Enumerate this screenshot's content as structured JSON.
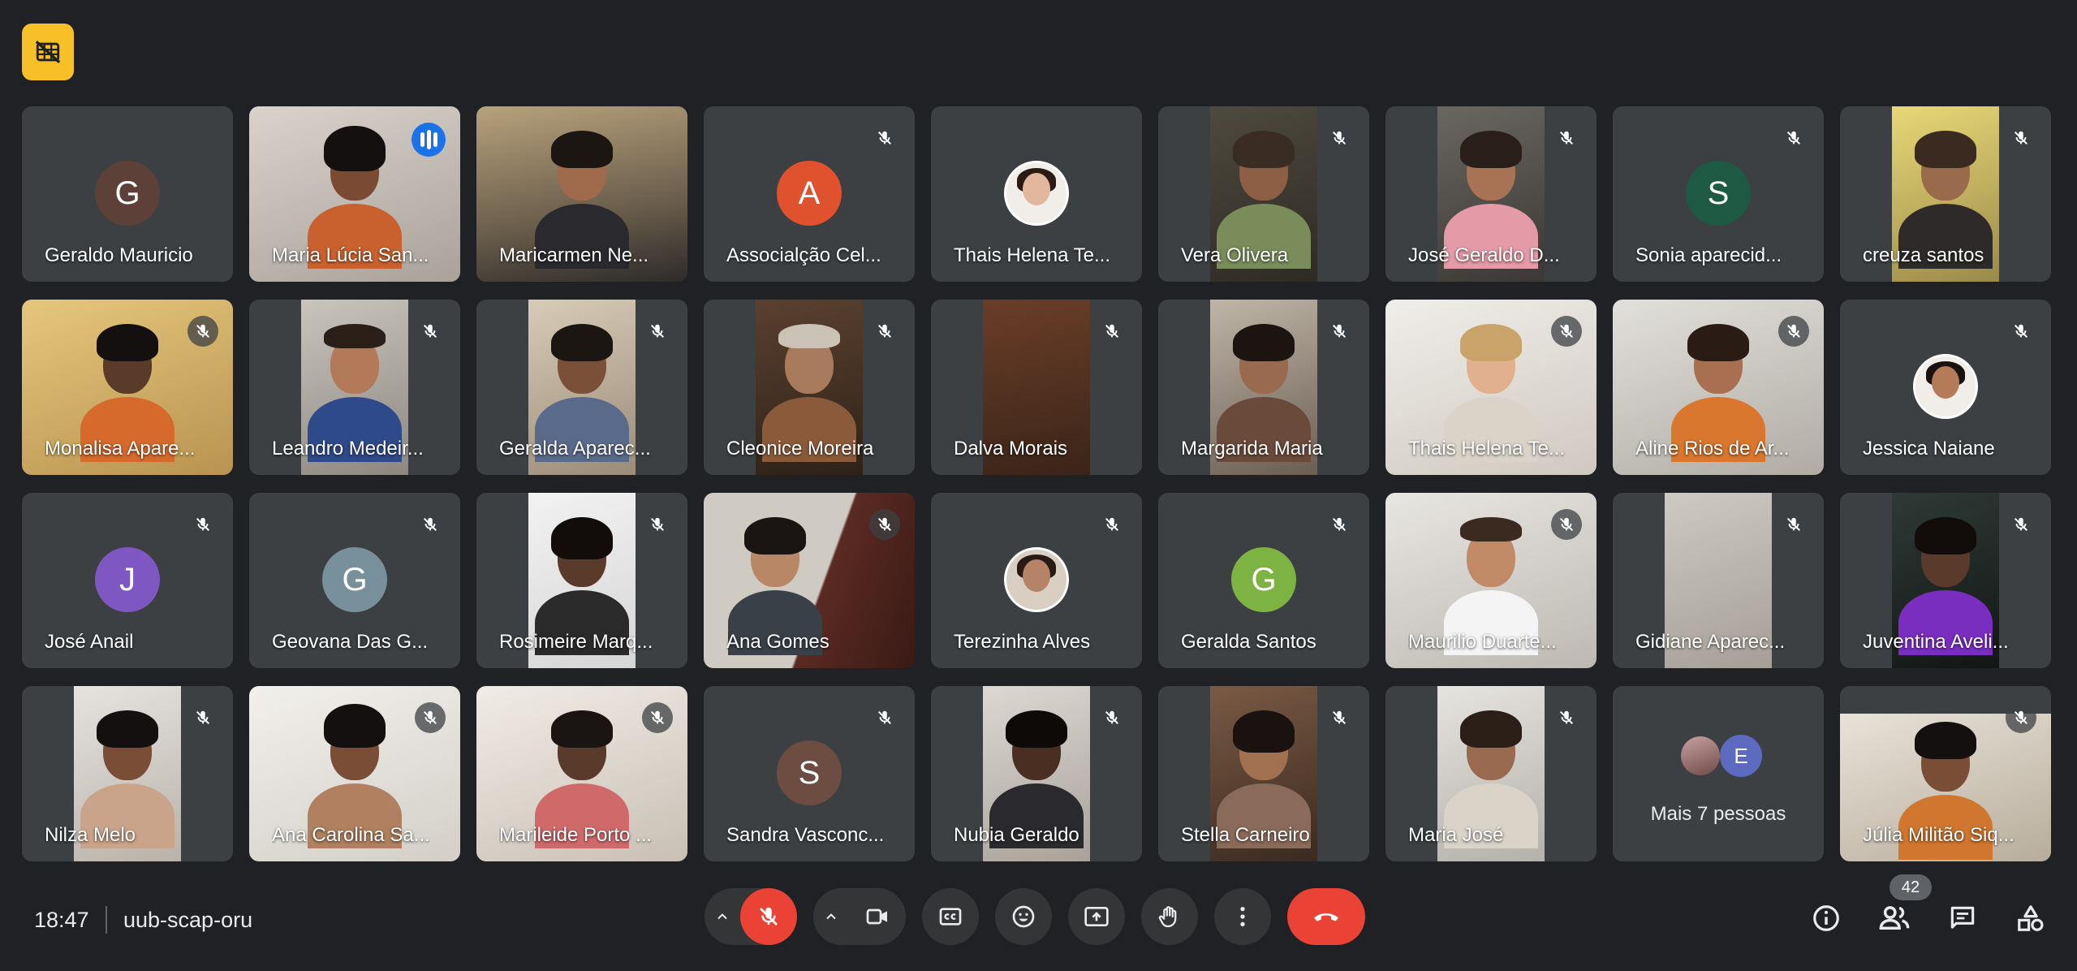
{
  "meeting": {
    "time": "18:47",
    "code": "uub-scap-oru",
    "participant_count": "42"
  },
  "colors": {
    "background": "#202124",
    "tile": "#3c4043",
    "mute_red": "#ea4335",
    "speaking_blue": "#1a73e8",
    "badge_yellow": "#f6c026"
  },
  "participants": [
    {
      "name": "Geraldo Mauricio",
      "initial": "G",
      "avatar_color": "#5d4037"
    },
    {
      "name": "Maria Lúcia San...",
      "speaking": true
    },
    {
      "name": "Maricarmen Ne..."
    },
    {
      "name": "Associalção Cel...",
      "initial": "A",
      "avatar_color": "#e0512e"
    },
    {
      "name": "Thais Helena Te..."
    },
    {
      "name": "Vera Olivera"
    },
    {
      "name": "José Geraldo D..."
    },
    {
      "name": "Sonia aparecid...",
      "initial": "S",
      "avatar_color": "#1e5a43"
    },
    {
      "name": "creuza santos"
    },
    {
      "name": "Monalisa Apare..."
    },
    {
      "name": "Leandro Medeir..."
    },
    {
      "name": "Geralda Aparec..."
    },
    {
      "name": "Cleonice Moreira"
    },
    {
      "name": "Dalva Morais"
    },
    {
      "name": "Margarida Maria"
    },
    {
      "name": "Thais Helena Te..."
    },
    {
      "name": "Aline Rios de Ar..."
    },
    {
      "name": "Jessica Naiane"
    },
    {
      "name": "José Anail",
      "initial": "J",
      "avatar_color": "#7e57c2"
    },
    {
      "name": "Geovana Das G...",
      "initial": "G",
      "avatar_color": "#78909c"
    },
    {
      "name": "Rosimeire Marq..."
    },
    {
      "name": "Ana Gomes"
    },
    {
      "name": "Terezinha Alves"
    },
    {
      "name": "Geralda Santos",
      "initial": "G",
      "avatar_color": "#7cb342"
    },
    {
      "name": "Maurilio Duarte..."
    },
    {
      "name": "Gidiane Aparec..."
    },
    {
      "name": "Juventina Aveli..."
    },
    {
      "name": "Nilza Melo"
    },
    {
      "name": "Ana Carolina Sa..."
    },
    {
      "name": "Marileide Porto ..."
    },
    {
      "name": "Sandra Vasconc...",
      "initial": "S",
      "avatar_color": "#6d4c41"
    },
    {
      "name": "Nubia Geraldo"
    },
    {
      "name": "Stella Carneiro"
    },
    {
      "name": "Maria José"
    },
    {
      "name": "Mais 7 pessoas",
      "more_initial": "E"
    },
    {
      "name": "Júlia Militão Siq..."
    }
  ]
}
